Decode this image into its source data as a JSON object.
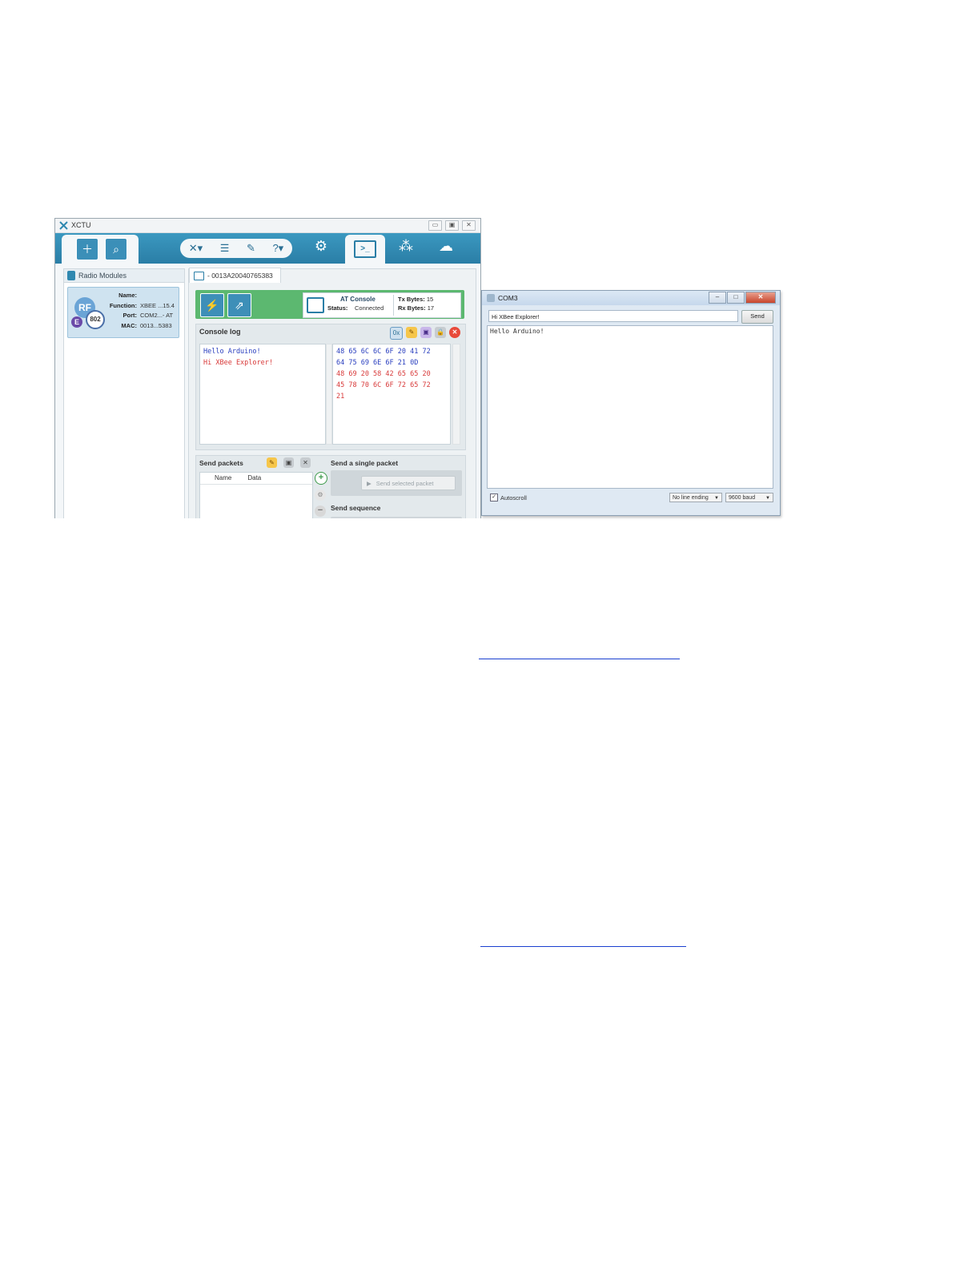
{
  "xctu": {
    "title": "XCTU",
    "window_buttons": [
      "▭",
      "▣",
      "✕"
    ],
    "toolbar": {
      "icons": [
        "add-device-icon",
        "discover-devices-icon",
        "tools-icon",
        "xctu-menu-icon",
        "feedback-icon",
        "help-icon",
        "configuration-icon",
        "consoles-icon",
        "network-icon",
        "cloud-icon"
      ],
      "accent": "#2f88b0"
    },
    "radio_modules": {
      "header": "Radio Modules",
      "module": {
        "badge_rf": "RF",
        "badge_e": "E",
        "badge_802": "802",
        "fields": [
          {
            "key": "Name:",
            "value": ""
          },
          {
            "key": "Function:",
            "value": "XBEE ...15.4"
          },
          {
            "key": "Port:",
            "value": "COM2...- AT"
          },
          {
            "key": "MAC:",
            "value": "0013...5383"
          }
        ]
      }
    },
    "device_tab": "- 0013A20040765383",
    "console_status": {
      "mode": "AT Console",
      "status_label": "Status:",
      "status_value": "Connected",
      "tx_label": "Tx Bytes:",
      "tx_value": "15",
      "rx_label": "Rx Bytes:",
      "rx_value": "17"
    },
    "console_log": {
      "header": "Console log",
      "ascii_lines": [
        {
          "text": "Hello Arduino!",
          "dir": "sent"
        },
        {
          "text": "Hi XBee Explorer!",
          "dir": "recv"
        }
      ],
      "hex_lines": [
        {
          "text": "48 65 6C 6C 6F 20 41 72",
          "dir": "sent"
        },
        {
          "text": "64 75 69 6E 6F 21 0D",
          "dir": "sent"
        },
        {
          "text": "48 69 20 58 42 65 65 20",
          "dir": "recv"
        },
        {
          "text": "45 78 70 6C 6F 72 65 72",
          "dir": "recv"
        },
        {
          "text": "21",
          "dir": "recv"
        }
      ],
      "colors": {
        "sent": "#2a3fbf",
        "recv": "#d83a3a"
      }
    },
    "send_packets": {
      "header": "Send packets",
      "columns": [
        "Name",
        "Data"
      ],
      "single_header": "Send a single packet",
      "send_selected_label": "Send selected packet",
      "sequence_header": "Send sequence"
    }
  },
  "com3": {
    "title": "COM3",
    "window_buttons": [
      "–",
      "□",
      "✕"
    ],
    "input_value": "Hi XBee Explorer!",
    "send_label": "Send",
    "output": "Hello Arduino!",
    "autoscroll_label": "Autoscroll",
    "line_ending": "No line ending",
    "baud": "9600 baud"
  }
}
